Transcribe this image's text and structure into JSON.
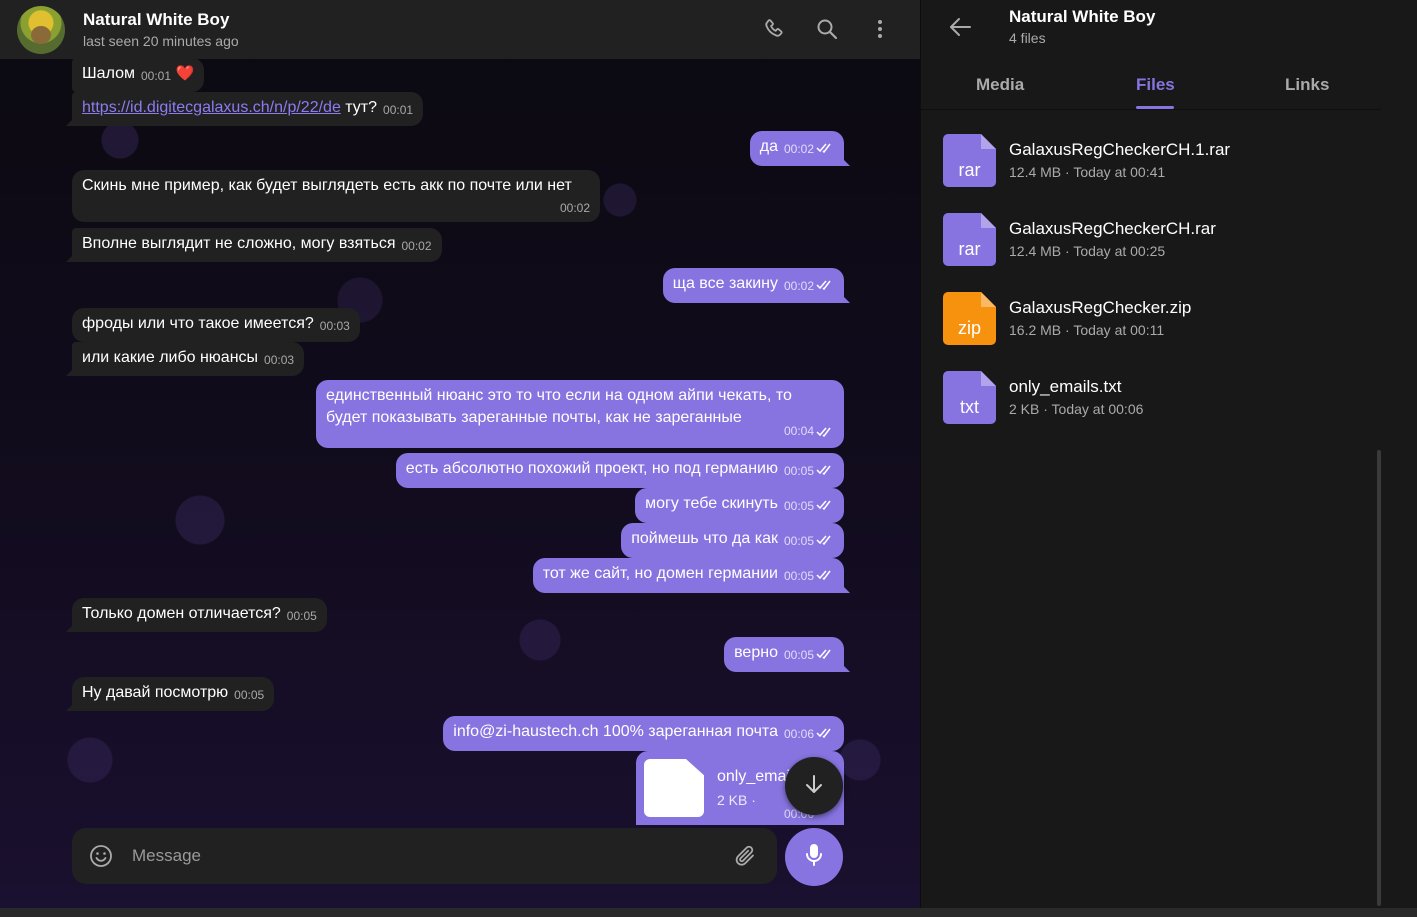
{
  "chat": {
    "name": "Natural White Boy",
    "status": "last seen 20 minutes ago",
    "composer_placeholder": "Message",
    "messages": [
      {
        "dir": "in",
        "text": "Шалом",
        "time": "00:01",
        "heart": "❤️"
      },
      {
        "dir": "in",
        "link": "https://id.digitecgalaxus.ch/n/p/22/de",
        "text": " тут?",
        "time": "00:01"
      },
      {
        "dir": "out",
        "text": "да",
        "time": "00:02"
      },
      {
        "dir": "in",
        "text": "Скинь мне пример, как будет выглядеть есть акк по почте или нет",
        "time": "00:02"
      },
      {
        "dir": "in",
        "text": "Вполне выглядит не сложно, могу взяться",
        "time": "00:02"
      },
      {
        "dir": "out",
        "text": "ща все закину",
        "time": "00:02"
      },
      {
        "dir": "in",
        "text": "фроды или что такое имеется?",
        "time": "00:03"
      },
      {
        "dir": "in",
        "text": "или какие либо нюансы",
        "time": "00:03"
      },
      {
        "dir": "out",
        "text": "единственный нюанс это то что если на одном айпи чекать, то будет показывать зареганные почты, как не зареганные",
        "time": "00:04"
      },
      {
        "dir": "out",
        "text": "есть абсолютно похожий проект, но под германию",
        "time": "00:05"
      },
      {
        "dir": "out",
        "text": "могу тебе скинуть",
        "time": "00:05"
      },
      {
        "dir": "out",
        "text": "поймешь что да как",
        "time": "00:05"
      },
      {
        "dir": "out",
        "text": "тот же сайт, но домен германии",
        "time": "00:05"
      },
      {
        "dir": "in",
        "text": "Только домен отличается?",
        "time": "00:05"
      },
      {
        "dir": "out",
        "text": "верно",
        "time": "00:05"
      },
      {
        "dir": "in",
        "text": "Ну давай посмотрю",
        "time": "00:05"
      },
      {
        "dir": "out",
        "text": "info@zi-haustech.ch 100% зареганная почта",
        "time": "00:06"
      }
    ],
    "file_message": {
      "name": "only_emails.txt",
      "meta": "2 KB ·",
      "time": "00:06"
    }
  },
  "side": {
    "title": "Natural White Boy",
    "subtitle": "4 files",
    "tabs": [
      "Media",
      "Files",
      "Links"
    ],
    "active_tab": "Files",
    "files": [
      {
        "ext": "rar",
        "name": "GalaxusRegCheckerCH.1.rar",
        "meta": "12.4 MB · Today at 00:41",
        "color": "#8774e1"
      },
      {
        "ext": "rar",
        "name": "GalaxusRegCheckerCH.rar",
        "meta": "12.4 MB · Today at 00:25",
        "color": "#8774e1"
      },
      {
        "ext": "zip",
        "name": "GalaxusRegChecker.zip",
        "meta": "16.2 MB · Today at 00:11",
        "color": "#f7920f"
      },
      {
        "ext": "txt",
        "name": "only_emails.txt",
        "meta": "2 KB · Today at 00:06",
        "color": "#8774e1"
      }
    ]
  },
  "colors": {
    "accent": "#8774e1",
    "incoming": "#212121",
    "zip": "#f7920f"
  }
}
